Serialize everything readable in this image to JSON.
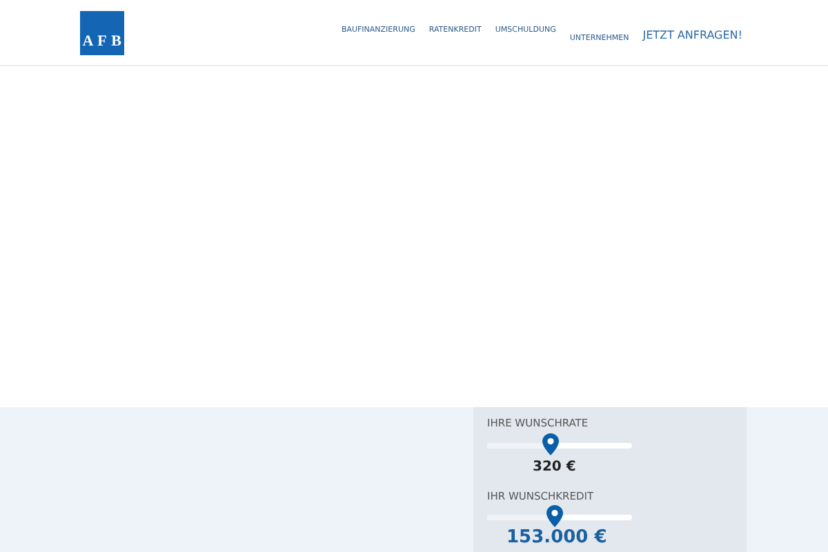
{
  "logo": {
    "letters": [
      "A",
      "F",
      "B"
    ]
  },
  "nav": [
    {
      "label": "BAUFINANZIERUNG",
      "kind": "link"
    },
    {
      "label": "RATENKREDIT",
      "kind": "link"
    },
    {
      "label": "UMSCHULDUNG",
      "kind": "link"
    },
    {
      "label": "UNTERNEHMEN",
      "kind": "link"
    },
    {
      "label": "JETZT ANFRAGEN!",
      "kind": "cta"
    }
  ],
  "calculator": {
    "sliders": [
      {
        "label": "IHRE WUNSCHRATE",
        "level": 0.44,
        "reading": "320 €"
      },
      {
        "label": "IHR WUNSCHKREDIT",
        "level": 0.47,
        "reading": "153.000 €"
      }
    ]
  }
}
